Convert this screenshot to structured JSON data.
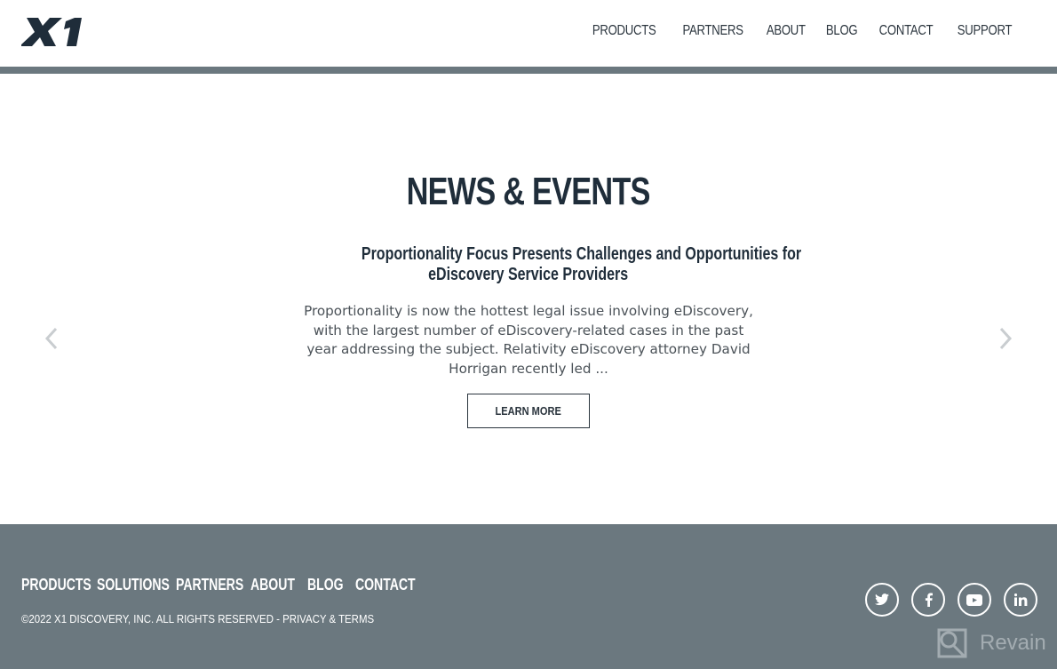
{
  "header": {
    "logo_text": "X1",
    "nav": [
      "PRODUCTS",
      "PARTNERS",
      "ABOUT",
      "BLOG",
      "CONTACT",
      "SUPPORT"
    ]
  },
  "main": {
    "section_title": "NEWS & EVENTS",
    "article": {
      "title_line1": "Proportionality Focus Presents Challenges and Opportunities for",
      "title_line2": "eDiscovery Service Providers",
      "excerpt": "Proportionality is now the hottest legal issue involving eDiscovery, with the largest number of eDiscovery-related cases in the past year addressing the subject. Relativity eDiscovery attorney David Horrigan recently led ...",
      "button_label": "LEARN MORE"
    },
    "carousel": {
      "prev_icon": "chevron-left-icon",
      "next_icon": "chevron-right-icon"
    }
  },
  "footer": {
    "nav": [
      "PRODUCTS",
      "SOLUTIONS",
      "PARTNERS",
      "ABOUT",
      "BLOG",
      "CONTACT"
    ],
    "copyright": "©2022 X1 DISCOVERY, INC. ALL RIGHTS RESERVED - PRIVACY & TERMS",
    "social": [
      "twitter-icon",
      "facebook-icon",
      "youtube-icon",
      "linkedin-icon"
    ],
    "watermark": "Revain"
  },
  "colors": {
    "primary_text": "#1f2d3a",
    "bar_and_footer": "#6b787f",
    "body_text": "#4b5258"
  }
}
